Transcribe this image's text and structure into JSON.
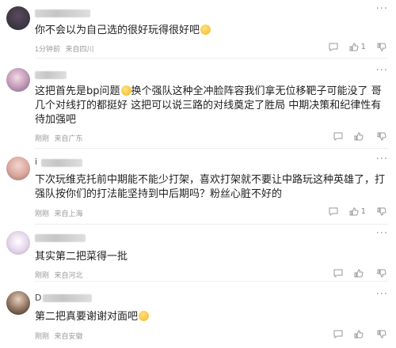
{
  "comments": [
    {
      "text": "你不会以为自己选的很好玩得很好吧",
      "emoji": "smirk-emoji",
      "time": "1分钟前",
      "location": "来自四川",
      "likes": "1"
    },
    {
      "text": "这把首先是bp问题",
      "text_after_emoji": "换个强队这种全冲脸阵容我们拿无位移靶子可能没了 哥几个对线打的都挺好 这把可以说三路的对线奠定了胜局 中期决策和纪律性有待加强吧",
      "emoji": "sweat-emoji",
      "time": "刚刚",
      "location": "来自广东",
      "likes": ""
    },
    {
      "name_prefix": "i",
      "text": "下次玩维克托前中期能不能少打架，喜欢打架就不要让中路玩这种英雄了，打强队按你们的打法能坚持到中后期吗？粉丝心脏不好的",
      "time": "刚刚",
      "location": "来自上海",
      "likes": "1"
    },
    {
      "text": "其实第二把菜得一批",
      "time": "刚刚",
      "location": "来自河北",
      "likes": ""
    },
    {
      "name_prefix": "D",
      "text": "第二把真要谢谢对面吧",
      "emoji": "grin-emoji",
      "time": "刚刚",
      "location": "来自安徽",
      "likes": ""
    }
  ],
  "more_label": "···",
  "colors": {
    "meta": "#9a9a9a",
    "text": "#222222",
    "divider": "#eeeeee"
  }
}
